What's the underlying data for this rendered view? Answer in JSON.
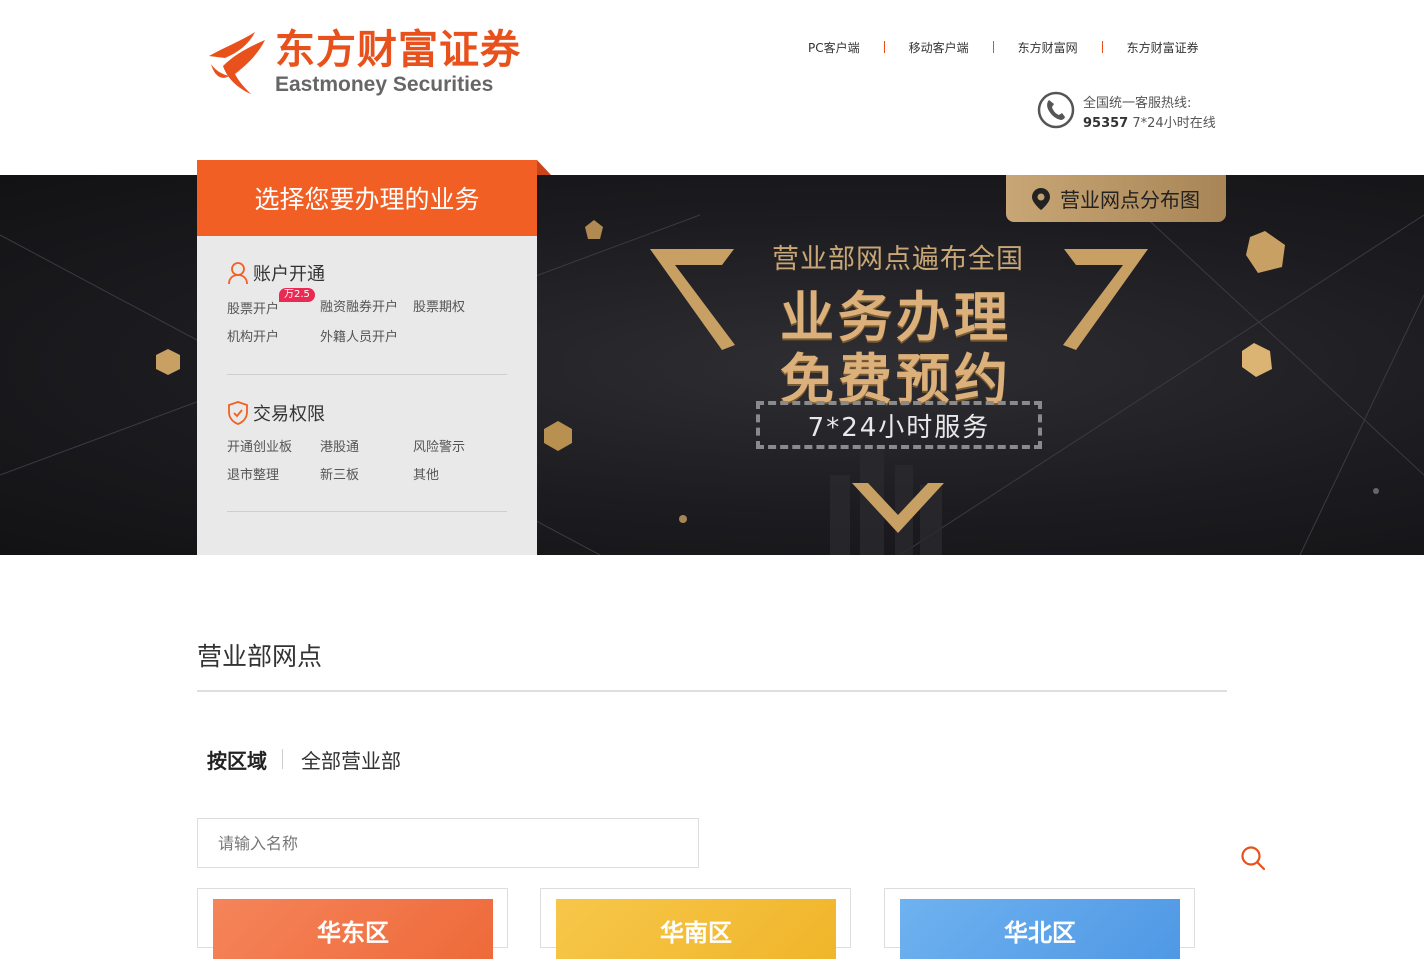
{
  "brand": {
    "name_cn": "东方财富证券",
    "name_en": "Eastmoney Securities",
    "color": "#e8511b"
  },
  "toplinks": [
    "PC客户端",
    "移动客户端",
    "东方财富网",
    "东方财富证券"
  ],
  "hotline": {
    "label": "全国统一客服热线:",
    "number": "95357",
    "hours": "7*24小时在线"
  },
  "banner": {
    "map_button": "营业网点分布图",
    "sub": "营业部网点遍布全国",
    "main1": "业务办理",
    "main2": "免费预约",
    "service": "7*24小时服务"
  },
  "panel": {
    "title": "选择您要办理的业务",
    "account": {
      "title": "账户开通",
      "items": [
        "股票开户",
        "融资融券开户",
        "股票期权",
        "机构开户",
        "外籍人员开户"
      ],
      "badge": "万2.5"
    },
    "trade": {
      "title": "交易权限",
      "items": [
        "开通创业板",
        "港股通",
        "风险警示",
        "退市整理",
        "新三板",
        "其他"
      ]
    }
  },
  "main": {
    "title": "营业部网点",
    "tabs": [
      "按区域",
      "全部营业部"
    ],
    "search_placeholder": "请输入名称",
    "regions": [
      {
        "name": "华东区",
        "color": "#f07a4e"
      },
      {
        "name": "华南区",
        "color": "#f5c13e"
      },
      {
        "name": "华北区",
        "color": "#5fa7ea"
      }
    ]
  }
}
